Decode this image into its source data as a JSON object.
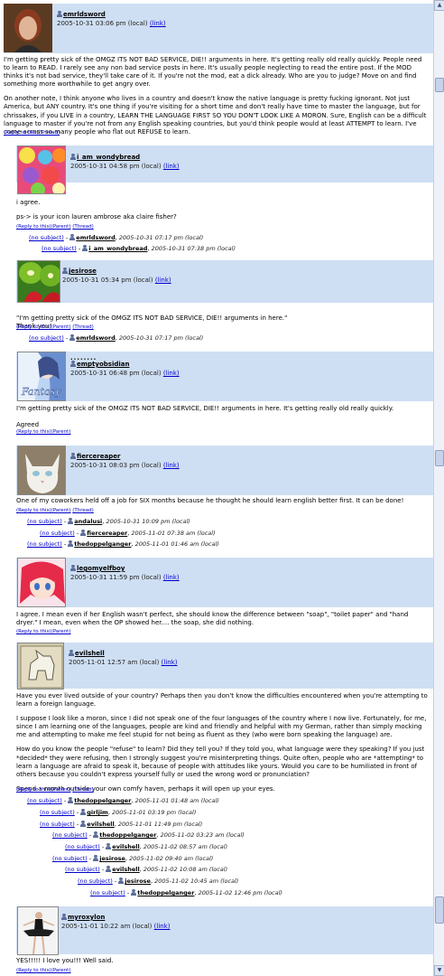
{
  "labels": {
    "reply": "(Reply to this)",
    "parent": "(Parent)",
    "thread": "(Thread)",
    "link": "(link)",
    "subject": "(no subject)",
    "dash": " - ",
    "scroll_up": "▲",
    "scroll_down": "▼"
  },
  "comments": [
    {
      "username": "emrldsword",
      "date": "2005-10-31 03:06 pm (local)",
      "paragraphs": [
        "I'm getting pretty sick of the OMGZ ITS NOT BAD SERVICE, DIE!! arguments in here. It's getting really old really quickly. People need to learn to READ. I rarely see any non bad service posts in here. It's usually people neglecting to read the entire post. If the MOD thinks it's not bad service, they'll take care of it. If you're not the mod, eat a dick already. Who are you to judge? Move on and find something more worthwhile to get angry over.",
        "On another note, I think anyone who lives in a country and doesn't know the native language is pretty fucking ignorant. Not just America, but ANY country. It's one thing if you're visiting for a short time and don't really have time to master the language, but for chrissakes, if you LIVE in a country, LEARN THE LANGUAGE FIRST SO YOU DON'T LOOK LIKE A MORON. Sure, English can be a difficult language to master if you're not from any English speaking countries, but you'd think people would at least ATTEMPT to learn. I've come across so many people who flat out REFUSE to learn."
      ]
    },
    {
      "username": "i_am_wondybread",
      "date": "2005-10-31 04:58 pm (local)",
      "paragraphs": [
        "i agree.",
        "ps-> is your icon lauren ambrose aka claire fisher?"
      ]
    },
    {
      "username": "jesirose",
      "date": "2005-10-31 05:34 pm (local)",
      "paragraphs": [
        "\"I'm getting pretty sick of the OMGZ ITS NOT BAD SERVICE, DIE!! arguments in here.\"\nThank you!"
      ]
    },
    {
      "username": "emptyobsidian",
      "date": "2005-10-31 06:48 pm (local)",
      "dots": "........",
      "avatar_text": "Fantasy",
      "paragraphs": [
        "I'm getting pretty sick of the OMGZ ITS NOT BAD SERVICE, DIE!! arguments in here. It's getting really old really quickly.",
        "Agreed"
      ]
    },
    {
      "username": "fiercereaper",
      "date": "2005-10-31 08:03 pm (local)",
      "paragraphs": [
        "One of my coworkers held off a job for SIX months because he thought he should learn english better first. It can be done!"
      ]
    },
    {
      "username": "legomyelfboy",
      "date": "2005-10-31 11:59 pm (local)",
      "paragraphs": [
        "I agree. I mean even if her English wasn't perfect, she should know the difference between \"soap\", \"toilet paper\" and \"hand dryer.\" I mean, even when the OP showed her.... the soap, she did nothing."
      ]
    },
    {
      "username": "evilshell",
      "date": "2005-11-01 12:57 am (local)",
      "paragraphs": [
        "Have you ever lived outside of your country? Perhaps then you don't know the difficulties encountered when you're attempting to learn a foreign language.",
        "I suppose I look like a moron, since I did not speak one of the four languages of the country where I now live. Fortunately, for me, since I am learning one of the languages, people are kind and friendly and helpful with my German, rather than simply mocking me and attempting to make me feel stupid for not being as fluent as they (who were born speaking the language) are.",
        "How do you know the people \"refuse\" to learn? Did they tell you? If they told you, what language were they speaking? If you just *decided* they were refusing, then I strongly suggest you're misinterpreting things. Quite often, people who are *attempting* to learn a language are afraid to speak it, because of people with attitudes like yours. Would you care to be humiliated in front of others because you couldn't express yourself fully or used the wrong word or pronunciation?",
        "Spend a month outside your own comfy haven, perhaps it will open up your eyes."
      ]
    },
    {
      "username": "myroxylon",
      "date": "2005-11-01 10:22 am (local)",
      "paragraphs": [
        "YES!!!!! I love you!!! Well said."
      ]
    }
  ],
  "threads": [
    {
      "user": "emrldsword",
      "date": "2005-10-31 07:17 pm (local)"
    },
    {
      "user": "i_am_wondybread",
      "date": "2005-10-31 07:38 pm (local)"
    },
    {
      "user": "emrldsword",
      "date": "2005-10-31 07:17 pm (local)"
    },
    {
      "user": "andalusi",
      "date": "2005-10-31 10:09 pm (local)"
    },
    {
      "user": "fiercereaper",
      "date": "2005-11-01 07:38 am (local)"
    },
    {
      "user": "thedoppelganger",
      "date": "2005-11-01 01:46 am (local)"
    },
    {
      "user": "thedoppelganger",
      "date": "2005-11-01 01:48 am (local)"
    },
    {
      "user": "girljim",
      "date": "2005-11-01 03:19 pm (local)"
    },
    {
      "user": "evilshell",
      "date": "2005-11-01 11:49 pm (local)"
    },
    {
      "user": "thedoppelganger",
      "date": "2005-11-02 03:23 am (local)"
    },
    {
      "user": "evilshell",
      "date": "2005-11-02 08:57 am (local)"
    },
    {
      "user": "jesirose",
      "date": "2005-11-02 09:40 am (local)"
    },
    {
      "user": "evilshell",
      "date": "2005-11-02 10:08 am (local)"
    },
    {
      "user": "jesirose",
      "date": "2005-11-02 10:45 am (local)"
    },
    {
      "user": "thedoppelganger",
      "date": "2005-11-02 12:46 pm (local)"
    }
  ],
  "colors": {
    "header_bg": "#cfdff3",
    "link": "#0000cc",
    "scrollbar": "#eef1f7"
  }
}
